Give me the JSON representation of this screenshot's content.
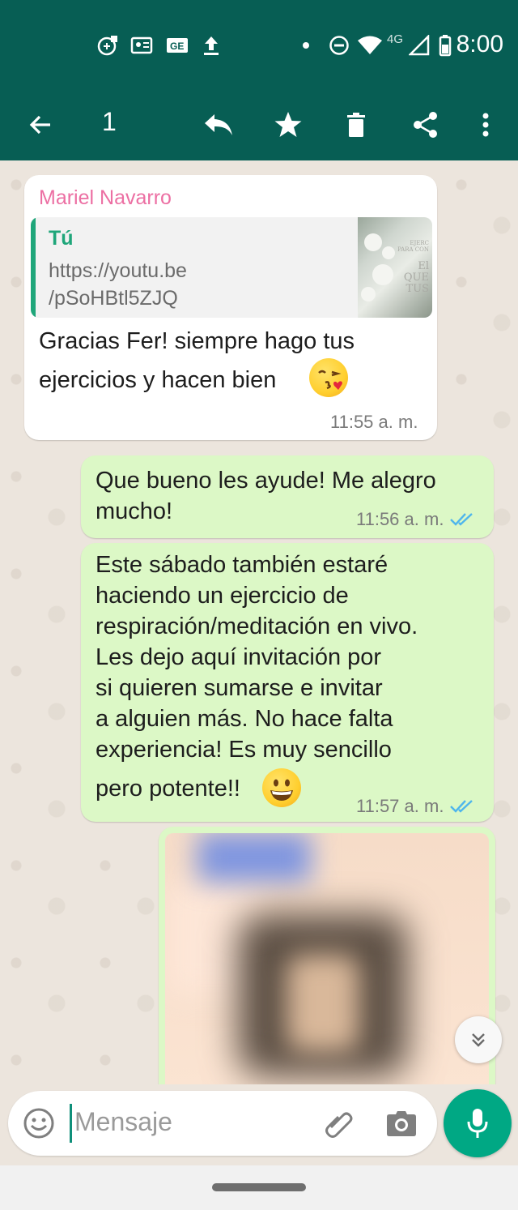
{
  "status_bar": {
    "time": "8:00",
    "network_label": "4G",
    "icons": [
      "sync-icon",
      "contacts-icon",
      "translate-icon",
      "upload-icon",
      "dot-icon",
      "dnd-icon",
      "wifi-icon",
      "signal-icon",
      "battery-icon"
    ]
  },
  "action_bar": {
    "selected_count": "1",
    "icons": [
      "back-arrow-icon",
      "reply-icon",
      "star-icon",
      "delete-icon",
      "share-icon",
      "more-vert-icon"
    ]
  },
  "messages": [
    {
      "direction": "incoming",
      "sender": "Mariel Navarro",
      "quote": {
        "author": "Tú",
        "line1": "https://youtu.be",
        "line2": "/pSoHBtl5ZJQ",
        "thumb_text": [
          "EJERC",
          "PARA CON",
          "El",
          "QUE",
          "TUS"
        ]
      },
      "text_line1": "Gracias Fer! siempre hago tus",
      "text_line2": "ejercicios y hacen bien",
      "emoji": "kissing-face-emoji",
      "time": "11:55 a. m."
    },
    {
      "direction": "outgoing",
      "text": "Que bueno les ayude! Me alegro\nmucho!",
      "time": "11:56 a. m.",
      "ticks": "double-check-read"
    },
    {
      "direction": "outgoing",
      "text": "Este sábado también estaré\nhaciendo un ejercicio de\nrespiración/meditación en vivo.\nLes dejo aquí invitación por\nsi quieren sumarse e invitar\na alguien más. No hace falta\nexperiencia! Es muy sencillo",
      "text_last": "pero potente!!",
      "emoji": "grinning-face-emoji",
      "time": "11:57 a. m.",
      "ticks": "double-check-read"
    },
    {
      "direction": "outgoing",
      "type": "image",
      "content": "blurred-image"
    }
  ],
  "composer": {
    "placeholder": "Mensaje"
  },
  "colors": {
    "header": "#075e54",
    "outgoing_bubble": "#dcf8c6",
    "incoming_bubble": "#ffffff",
    "accent": "#00a884",
    "sender_name": "#ec6fa3",
    "read_ticks": "#4fb6ec"
  }
}
